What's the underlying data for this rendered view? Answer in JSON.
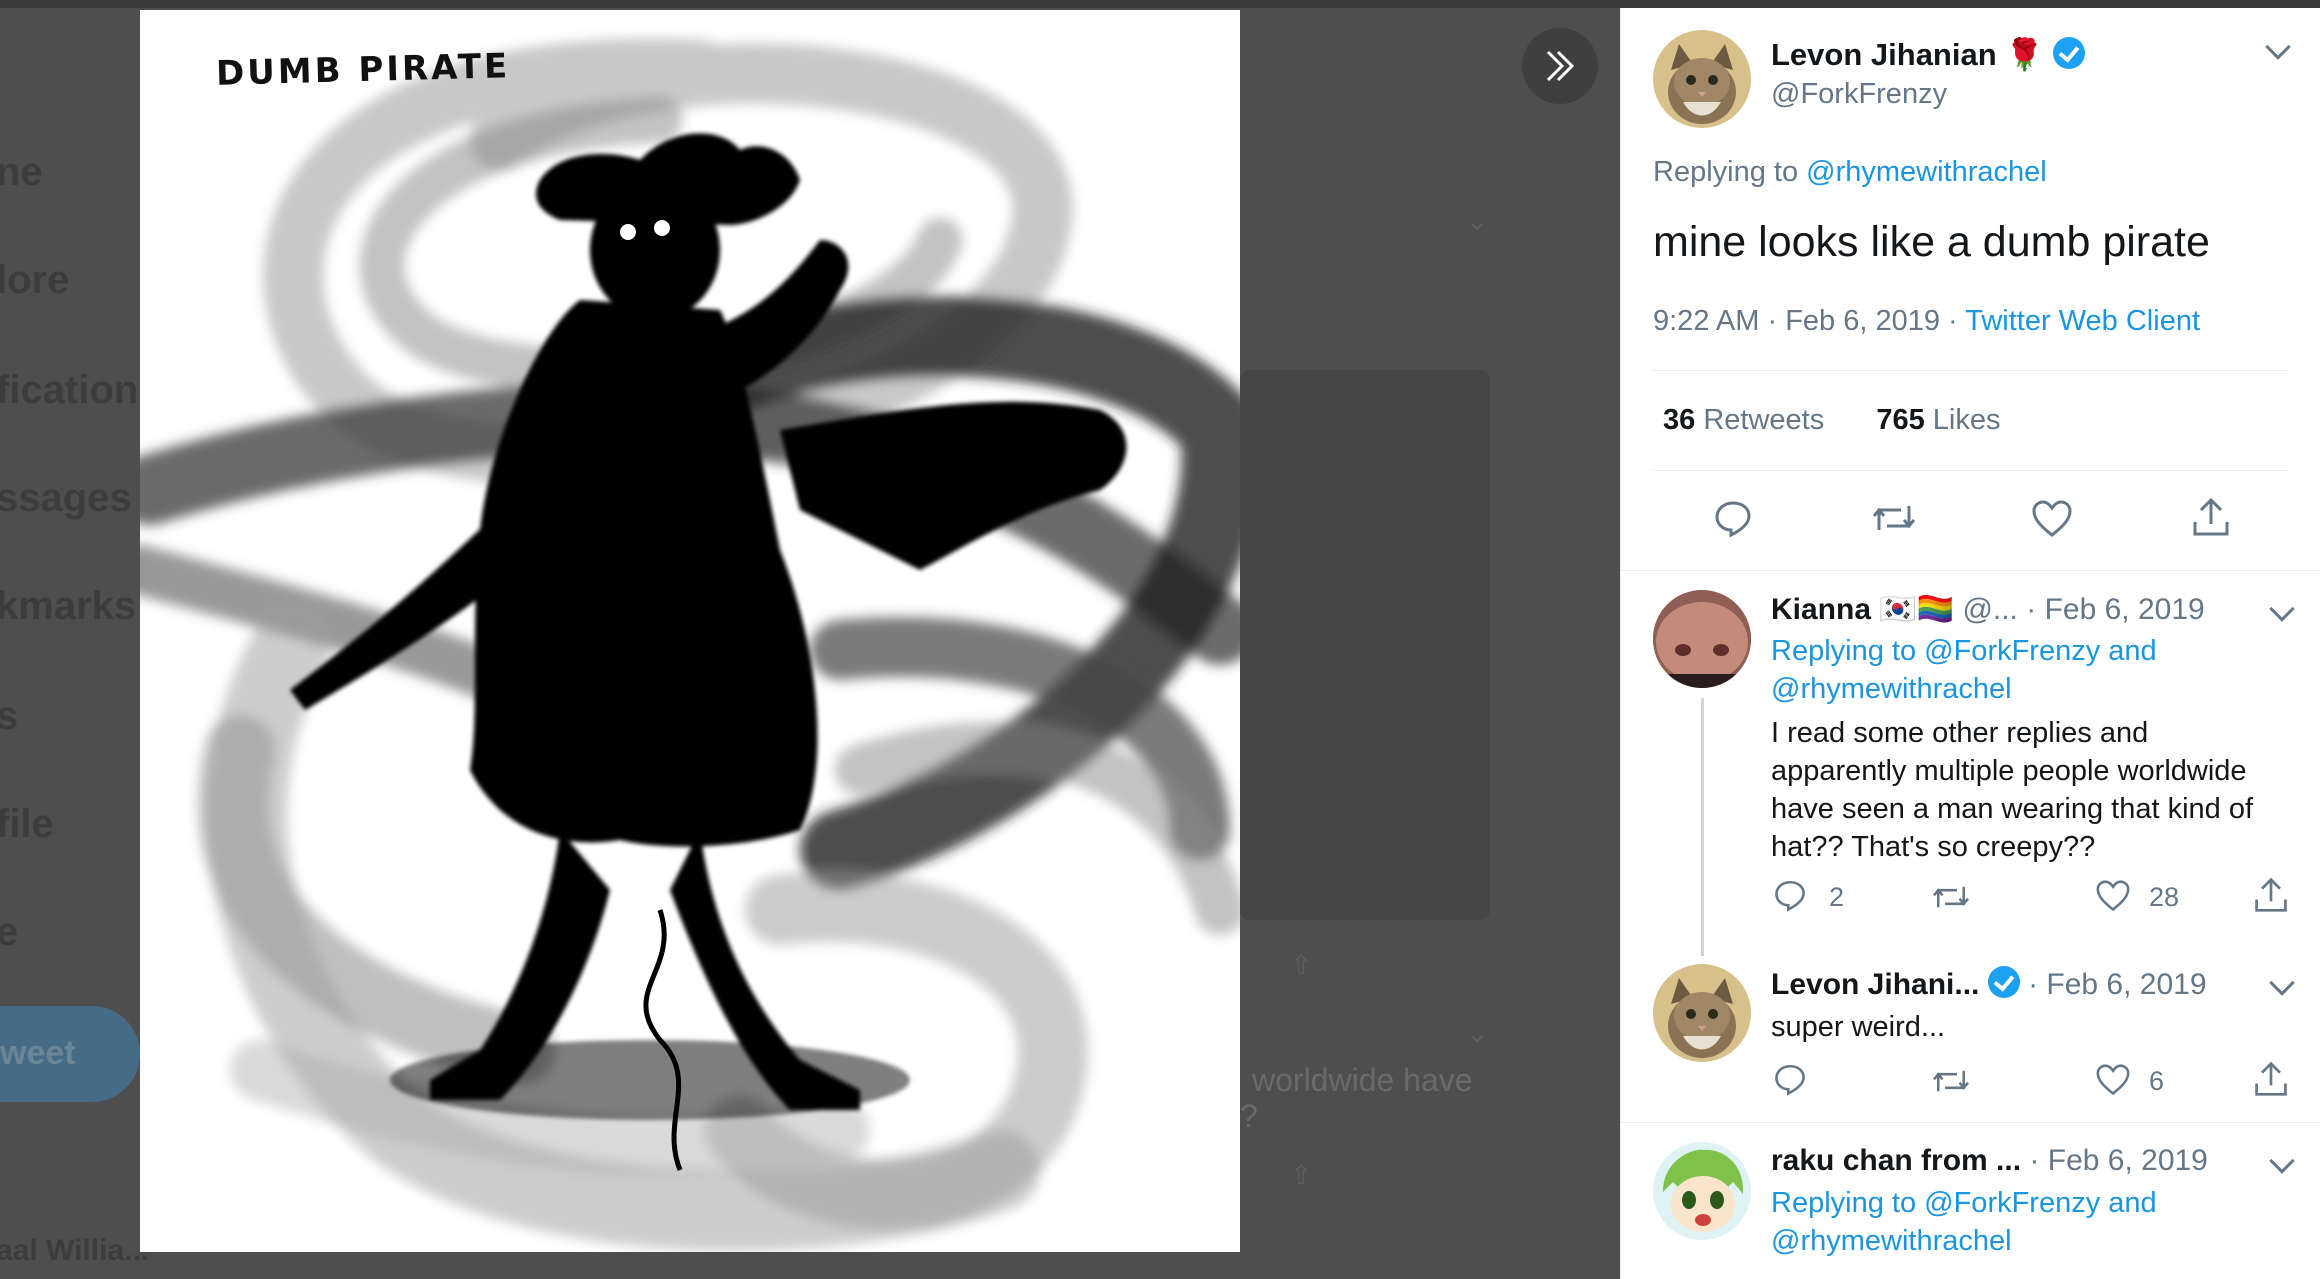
{
  "background": {
    "nav_ghosts": [
      "ne",
      "lore",
      "fication",
      "ssages",
      "kmarks",
      "s",
      "file",
      "e"
    ],
    "tweet_button_label": "weet",
    "ghost_user": "aal Willia...",
    "ghost_snippet_1": "worldwide have",
    "ghost_snippet_2": "?"
  },
  "media": {
    "caption": "DUMB PIRATE",
    "description_icon": "pirate-silhouette-drawing"
  },
  "collapse_button_icon": "double-chevron-right-icon",
  "main_tweet": {
    "display_name": "Levon Jihanian",
    "emoji": "🌹",
    "handle": "@ForkFrenzy",
    "replying_prefix": "Replying to",
    "replying_handle": "@rhymewithrachel",
    "text": "mine looks like a dumb pirate",
    "time": "9:22 AM",
    "date": "Feb 6, 2019",
    "client": "Twitter Web Client",
    "retweets_count": "36",
    "retweets_label": "Retweets",
    "likes_count": "765",
    "likes_label": "Likes"
  },
  "replies": [
    {
      "display_name": "Kianna",
      "flags": "🇰🇷🏳️‍🌈",
      "handle": "@...",
      "date": "· Feb 6, 2019",
      "replying_prefix": "Replying to",
      "replying_handle_1": "@ForkFrenzy",
      "replying_and": "and",
      "replying_handle_2": "@rhymewithrachel",
      "text": "I read some other replies and apparently multiple people worldwide have seen a man wearing that kind of hat?? That's so creepy??",
      "reply_count": "2",
      "retweet_count": "",
      "like_count": "28"
    },
    {
      "display_name": "Levon Jihani...",
      "date": "· Feb 6, 2019",
      "text": "super weird...",
      "reply_count": "",
      "retweet_count": "",
      "like_count": "6"
    },
    {
      "display_name": "raku chan from ...",
      "date": "· Feb 6, 2019",
      "replying_prefix": "Replying to",
      "replying_handle_1": "@ForkFrenzy",
      "replying_and": "and",
      "replying_handle_2": "@rhymewithrachel"
    }
  ],
  "colors": {
    "link": "#1b95e0",
    "verified": "#1da1f2",
    "muted": "#657786",
    "text": "#14171a"
  }
}
